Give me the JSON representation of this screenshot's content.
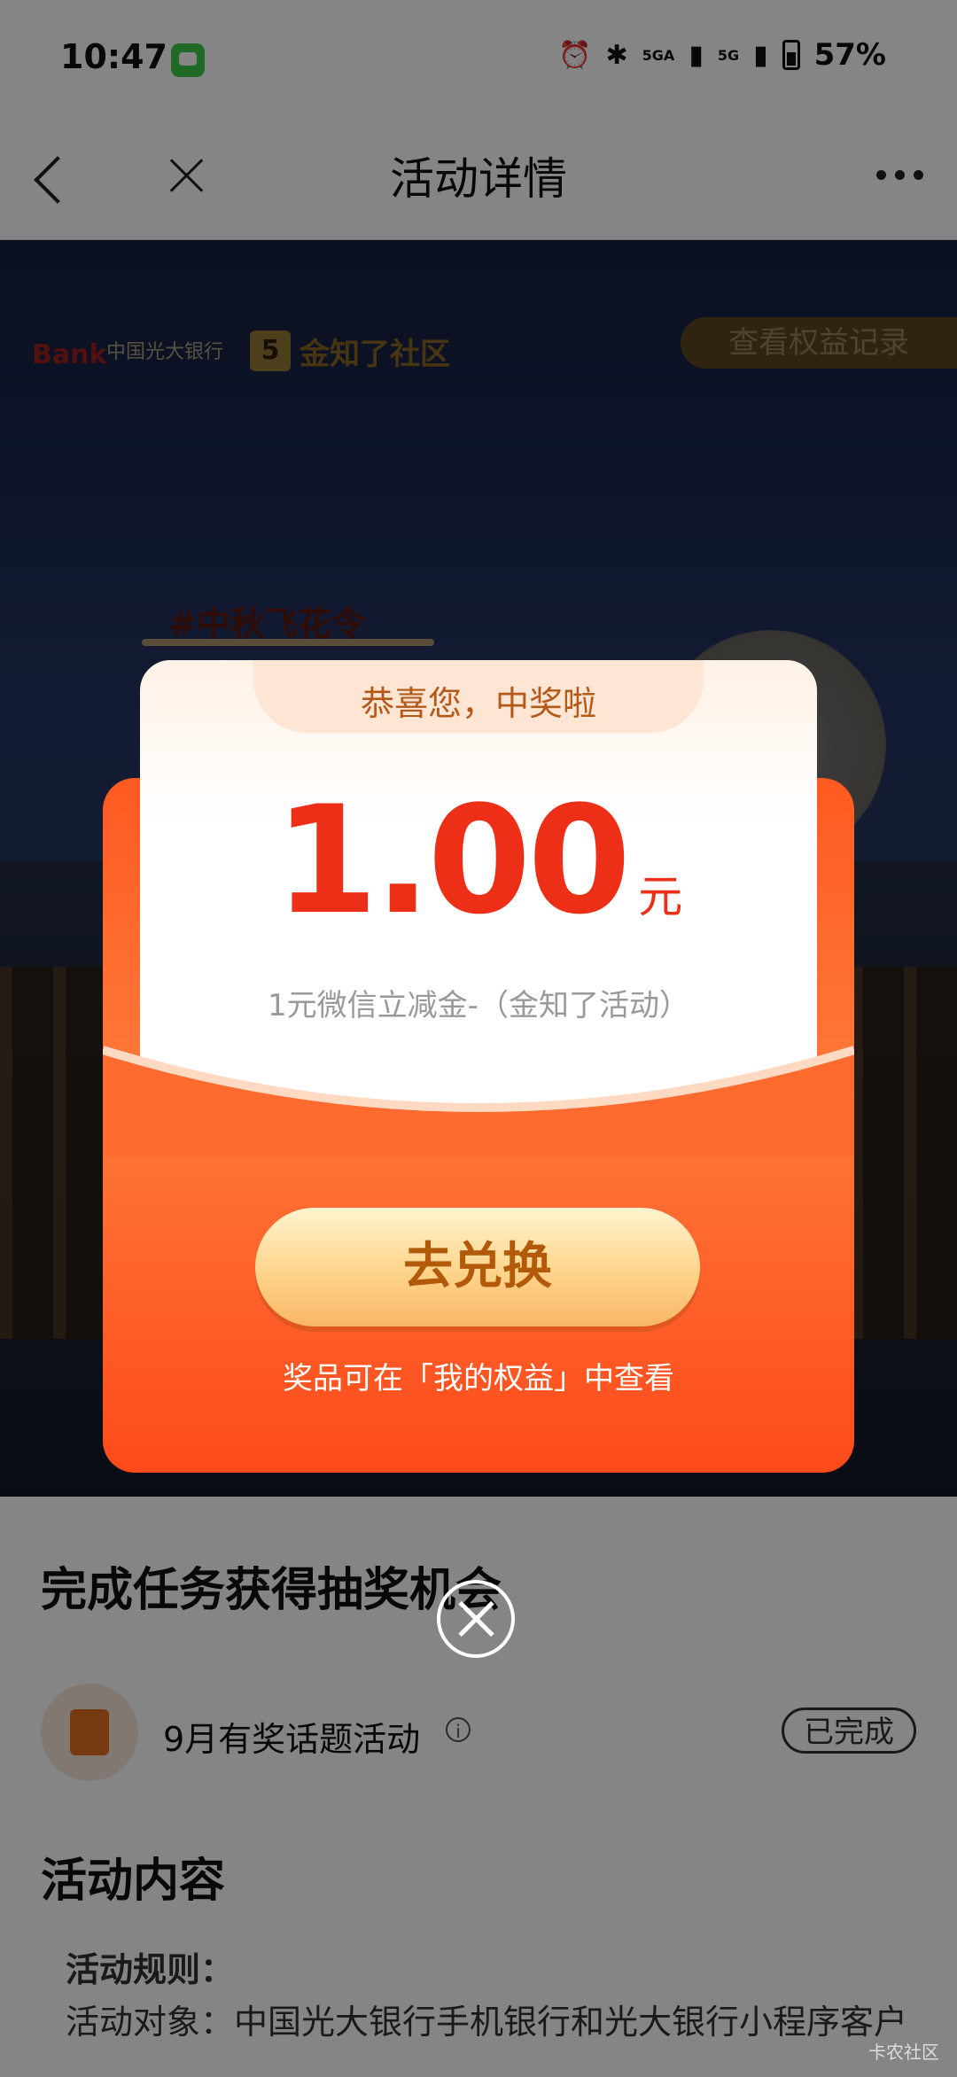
{
  "status_bar": {
    "time": "10:47",
    "net1": "5GA",
    "net2": "5G",
    "battery": "57%"
  },
  "nav": {
    "title": "活动详情"
  },
  "hero": {
    "bank_logo": "Bank",
    "bank_name": "中国光大银行",
    "community_mark": "5",
    "community_name": "金知了社区",
    "rights_record_button": "查看权益记录",
    "hashtag": "#中秋飞花令"
  },
  "popup": {
    "congrats": "恭喜您，中奖啦",
    "amount": "1.00",
    "unit": "元",
    "prize_desc": "1元微信立减金-（金知了活动）",
    "redeem_button": "去兑换",
    "tip": "奖品可在「我的权益」中查看"
  },
  "content": {
    "tasks_heading": "完成任务获得抽奖机会",
    "task_label": "9月有奖话题活动",
    "task_status": "已完成",
    "activity_heading": "活动内容",
    "rules_title": "活动规则：",
    "rules_text": "活动对象：中国光大银行手机银行和光大银行小程序客户"
  },
  "watermark": "卡农社区"
}
